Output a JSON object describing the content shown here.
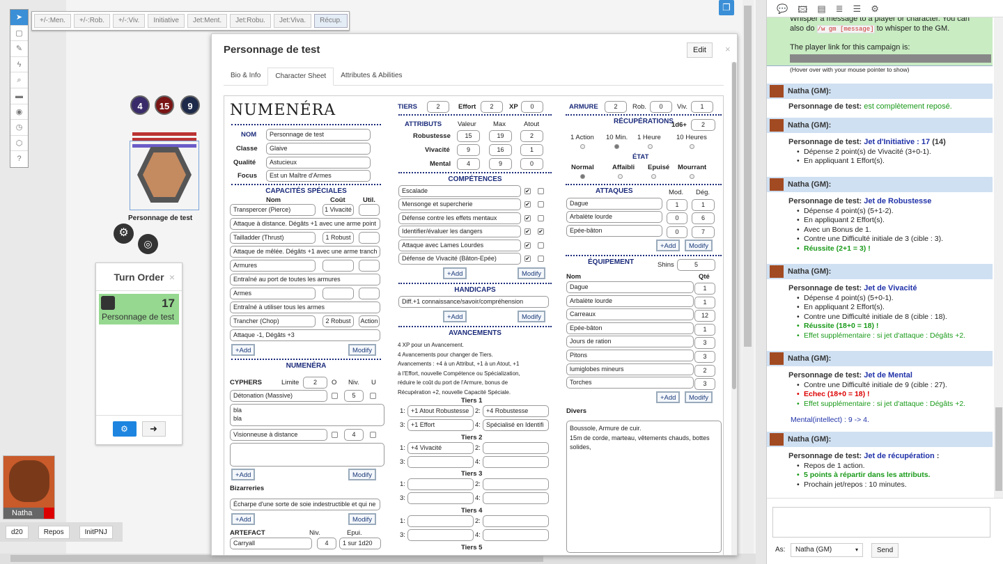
{
  "toolbar_macros": [
    "+/-:Men.",
    "+/-:Rob.",
    "+/-:Viv.",
    "Initiative",
    "Jet:Ment.",
    "Jet:Robu.",
    "Jet:Viva.",
    "Récup."
  ],
  "token": {
    "badges": [
      "4",
      "15",
      "9"
    ],
    "name": "Personnage de test"
  },
  "turn_order": {
    "title": "Turn Order",
    "close": "×",
    "entry_name": "Personnage de test",
    "entry_value": "17"
  },
  "player": {
    "name": "Natha"
  },
  "dice_bar": [
    "d20",
    "Repos",
    "InitPNJ"
  ],
  "dialog": {
    "title": "Personnage de test",
    "edit": "Edit",
    "close": "×",
    "tabs": [
      "Bio & Info",
      "Character Sheet",
      "Attributes & Abilities"
    ]
  },
  "sheet": {
    "logo": "NUMENÉRA",
    "identity": {
      "labels": [
        "NOM",
        "Classe",
        "Qualité",
        "Focus"
      ],
      "values": [
        "Personnage de test",
        "Glaive",
        "Astucieux",
        "Est un Maître d'Armes"
      ]
    },
    "cap_title": "CAPACITÉS SPÉCIALES",
    "cap_headers": [
      "Nom",
      "Coût",
      "Util."
    ],
    "caps": [
      {
        "name": "Transpercer (Pierce)",
        "cost": "1 Vivacité",
        "desc": "Attaque à distance. Dégâts +1 avec une arme point"
      },
      {
        "name": "Tailladder (Thrust)",
        "cost": "1 Robust",
        "desc": "Attaque de mêlée. Dégâts +1 avec une arme tranch"
      },
      {
        "name": "Armures",
        "cost": "",
        "desc": "Entraîné au port de toutes les armures"
      },
      {
        "name": "Armes",
        "cost": "",
        "desc": "Entraîné à utiliser tous les armes"
      },
      {
        "name": "Trancher (Chop)",
        "cost": "2 Robust",
        "util": "Action",
        "desc": "Attaque -1, Dégâts +3"
      }
    ],
    "add": "+Add",
    "modify": "Modify",
    "numenera_title": "NUMENÉRA",
    "cyphers": {
      "label": "CYPHERS",
      "limite_label": "Limite",
      "limite": "2",
      "o": "O",
      "niv": "Niv.",
      "u": "U",
      "items": [
        {
          "name": "Détonation (Massive)",
          "niv": "5",
          "text": "bla\nbla"
        },
        {
          "name": "Visionneuse à distance",
          "niv": "4",
          "text": ""
        }
      ]
    },
    "bizarreries_label": "Bizarreries",
    "bizarrerie": "Écharpe d'une sorte de soie indestructible et qui ne",
    "artefact": {
      "label": "ARTEFACT",
      "niv_label": "Niv.",
      "epui_label": "Epui.",
      "name": "Carryall",
      "niv": "4",
      "epui": "1 sur 1d20"
    },
    "tiers": {
      "label": "TIERS",
      "value": "2",
      "effort_label": "Effort",
      "effort": "2",
      "xp_label": "XP",
      "xp": "0"
    },
    "attributs": {
      "title": "ATTRIBUTS",
      "cols": [
        "Valeur",
        "Max",
        "Atout"
      ],
      "rows": [
        {
          "name": "Robustesse",
          "v": "15",
          "m": "19",
          "a": "2"
        },
        {
          "name": "Vivacité",
          "v": "9",
          "m": "16",
          "a": "1"
        },
        {
          "name": "Mental",
          "v": "4",
          "m": "9",
          "a": "0"
        }
      ]
    },
    "comp_title": "COMPÉTENCES",
    "competences": [
      {
        "n": "Escalade",
        "a": true,
        "b": false
      },
      {
        "n": "Mensonge et supercherie",
        "a": true,
        "b": false
      },
      {
        "n": "Défense contre les effets mentaux",
        "a": true,
        "b": false
      },
      {
        "n": "Identifier/évaluer les dangers",
        "a": true,
        "b": true
      },
      {
        "n": "Attaque avec Lames Lourdes",
        "a": true,
        "b": false
      },
      {
        "n": "Défense de Vivacité (Bâton-Epée)",
        "a": true,
        "b": false
      }
    ],
    "handicaps_title": "HANDICAPS",
    "handicap": "Diff.+1 connaissance/savoir/compréhension",
    "avancements": {
      "title": "AVANCEMENTS",
      "text": [
        "4 XP pour un Avancement.",
        "4 Avancements pour changer de Tiers.",
        "Avancements : +4 à un Attribut, +1 à un Atout, +1",
        "à l'Effort, nouvelle Compétence ou Spécialization,",
        "réduire le coût du port de l'Armure, bonus de",
        "Récupération +2, nouvelle Capacité Spéciale."
      ],
      "tiers": [
        {
          "label": "Tiers 1",
          "slots": [
            "+1 Atout Robustesse",
            "+4 Robustesse",
            "+1 Effort",
            "Spécialisé en Identifi"
          ]
        },
        {
          "label": "Tiers 2",
          "slots": [
            "+4 Vivacité",
            "",
            "",
            ""
          ]
        },
        {
          "label": "Tiers 3",
          "slots": [
            "",
            "",
            "",
            ""
          ]
        },
        {
          "label": "Tiers 4",
          "slots": [
            "",
            "",
            "",
            ""
          ]
        },
        {
          "label": "Tiers 5"
        }
      ]
    },
    "armure": {
      "label": "ARMURE",
      "value": "2",
      "rob_label": "Rob.",
      "rob": "0",
      "viv_label": "Viv.",
      "viv": "1"
    },
    "recup": {
      "title": "RÉCUPÉRATIONS",
      "d6_label": "1d6+",
      "d6": "2",
      "options": [
        "1 Action",
        "10 Min.",
        "1 Heure",
        "10 Heures"
      ]
    },
    "etat": {
      "title": "ÉTAT",
      "options": [
        "Normal",
        "Affaibli",
        "Epuisé",
        "Mourrant"
      ]
    },
    "attaques": {
      "title": "ATTAQUES",
      "cols": [
        "Mod.",
        "Dég."
      ],
      "rows": [
        {
          "n": "Dague",
          "m": "1",
          "d": "1"
        },
        {
          "n": "Arbalète lourde",
          "m": "0",
          "d": "6"
        },
        {
          "n": "Epée-bâton",
          "m": "0",
          "d": "7"
        }
      ]
    },
    "equip": {
      "title": "ÉQUIPEMENT",
      "shins_label": "Shins",
      "shins": "5",
      "cols": [
        "Nom",
        "Qté"
      ],
      "rows": [
        {
          "n": "Dague",
          "q": "1"
        },
        {
          "n": "Arbalète lourde",
          "q": "1"
        },
        {
          "n": "Carreaux",
          "q": "12"
        },
        {
          "n": "Epée-bâton",
          "q": "1"
        },
        {
          "n": "Jours de ration",
          "q": "3"
        },
        {
          "n": "Pitons",
          "q": "3"
        },
        {
          "n": "lumiglobes mineurs",
          "q": "2"
        },
        {
          "n": "Torches",
          "q": "3"
        }
      ]
    },
    "divers": {
      "label": "Divers",
      "text": "Boussole, Armure de cuir.\n15m de corde, marteau, vêtements chauds,  bottes solides,"
    }
  },
  "chat": {
    "top_tabs": [
      "chat-icon",
      "art-icon",
      "journal-icon",
      "compendium-icon",
      "list-icon",
      "gear-icon"
    ],
    "intro": [
      "Whisper a message to a player or character. You can",
      "also do",
      "/w gm [message]",
      "to whisper to the GM."
    ],
    "link_label": "The player link for this campaign is:",
    "hover": "(Hover over with your mouse pointer to show)",
    "gm": "Natha (GM):",
    "sender": "Personnage de test:",
    "m1": "est complètement reposé.",
    "m2_title": "Jet d'Initiative : 17",
    "m2_tail": "(14)",
    "m2_lines": [
      "Dépense 2 point(s) de Vivacité (3+0-1).",
      "En appliquant 1 Effort(s)."
    ],
    "m3_title": "Jet de Robustesse",
    "m3_lines": [
      "Dépense 4 point(s) (5+1-2).",
      "En appliquant 2 Effort(s).",
      "Avec un Bonus de 1.",
      "Contre une Difficulté initiale de 3 (cible : 3).",
      "Réussite (2+1 = 3) !"
    ],
    "m4_title": "Jet de Vivacité",
    "m4_lines": [
      "Dépense 4 point(s) (5+0-1).",
      "En appliquant 2 Effort(s).",
      "Contre une Difficulté initiale de 8 (cible : 18).",
      "Réussite (18+0 = 18) !",
      "Effet supplémentaire : si jet d'attaque : Dégâts +2."
    ],
    "m5_title": "Jet de Mental",
    "m5_lines": [
      "Contre une Difficulté initiale de 9 (cible : 27).",
      "Echec (18+0 = 18) !",
      "Effet supplémentaire : si jet d'attaque : Dégâts +2."
    ],
    "m5_note": "Mental(intellect) : 9 -> 4.",
    "m6_title": "Jet de récupération",
    "m6_tail": ":",
    "m6_lines": [
      "Repos de 1 action.",
      "5 points à répartir dans les attributs.",
      "Prochain jet/repos : 10 minutes."
    ],
    "as_label": "As:",
    "as_value": "Natha (GM)",
    "send": "Send"
  }
}
